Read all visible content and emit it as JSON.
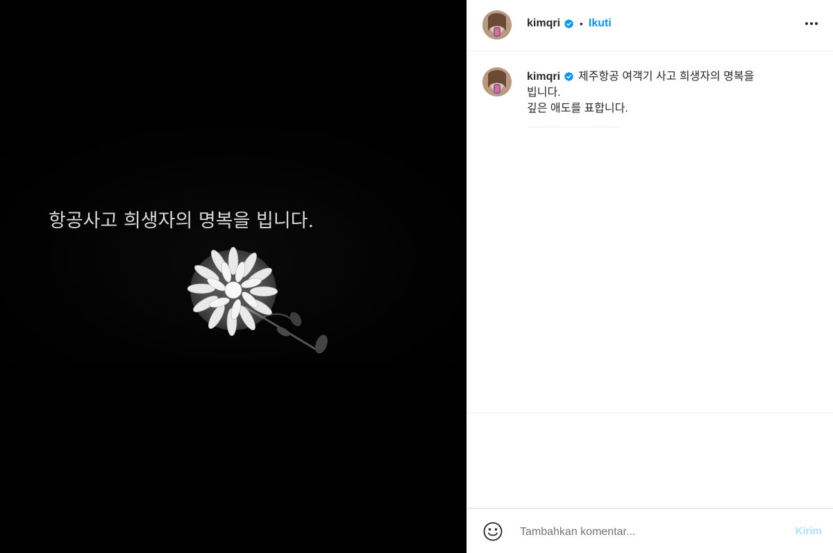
{
  "media": {
    "image_text": "항공사고 희생자의 명복을 빕니다."
  },
  "header": {
    "username": "kimqri",
    "separator": "•",
    "follow_label": "Ikuti",
    "more_icon": "more-horizontal-icon"
  },
  "caption": {
    "username": "kimqri",
    "lines": [
      "제주항공 여객기 사고 희생자의 명복을",
      "빕니다.",
      "깊은 애도를 표합니다."
    ]
  },
  "comment_bar": {
    "emoji_icon": "smiley-icon",
    "placeholder": "Tambahkan komentar...",
    "post_label": "Kirim"
  },
  "colors": {
    "accent": "#0095f6",
    "post_disabled": "#b2dffc",
    "verified": "#0095f6",
    "text": "#262626"
  }
}
